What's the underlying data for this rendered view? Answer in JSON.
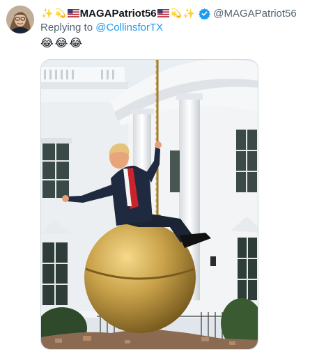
{
  "tweet": {
    "display_name": "MAGAPatriot56",
    "handle": "@MAGAPatriot56",
    "name_decorations": [
      "sparkles-icon",
      "comet-icon",
      "us-flag-icon"
    ],
    "verified_color": "#1d9bf0",
    "reply_prefix": "Replying to",
    "reply_to": "@CollinsforTX",
    "text_emojis": [
      "😂",
      "😂",
      "😂"
    ],
    "link_color": "#1d9bf0",
    "secondary_text_color": "#536471"
  }
}
